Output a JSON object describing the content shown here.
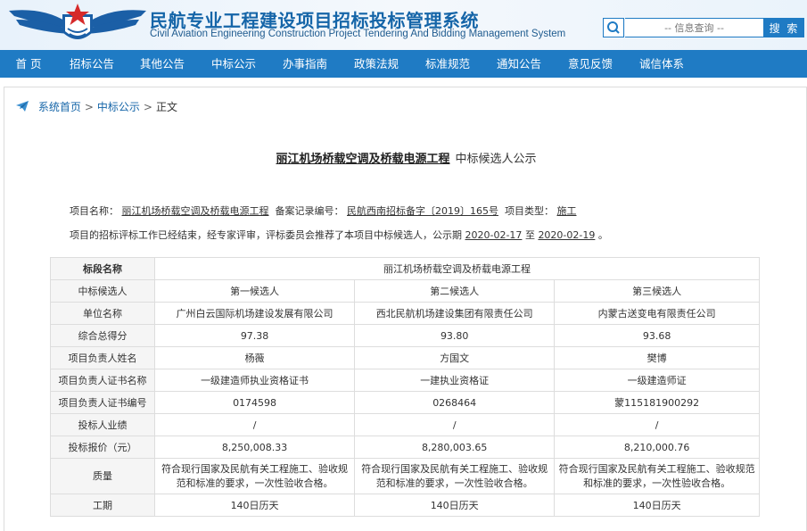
{
  "header": {
    "title_cn": "民航专业工程建设项目招标投标管理系统",
    "title_en": "Civil Aviation Engineering Construction Project Tendering And Bidding Management System",
    "search_placeholder": "-- 信息查询 --",
    "search_button": "搜 索"
  },
  "nav": {
    "items": [
      "首 页",
      "招标公告",
      "其他公告",
      "中标公示",
      "办事指南",
      "政策法规",
      "标准规范",
      "通知公告",
      "意见反馈",
      "诚信体系"
    ]
  },
  "breadcrumb": {
    "home": "系统首页",
    "section": "中标公示",
    "current": "正文",
    "separator": ">"
  },
  "document": {
    "title_project": "丽江机场桥载空调及桥载电源工程",
    "title_suffix": "中标候选人公示",
    "project_name_label": "项目名称：",
    "project_name": "丽江机场桥载空调及桥载电源工程",
    "record_no_label": "备案记录编号：",
    "record_no": "民航西南招标备字〔2019〕165号",
    "project_type_label": "项目类型：",
    "project_type": "施工",
    "notice_prefix": "项目的招标评标工作已经结束，经专家评审，评标委员会推荐了本项目中标候选人，公示期",
    "start_date": "2020-02-17",
    "to": "至",
    "end_date": "2020-02-19",
    "notice_end": "。"
  },
  "table": {
    "section_label": "标段名称",
    "section_name": "丽江机场桥载空调及桥载电源工程",
    "rows": [
      {
        "label": "中标候选人",
        "values": [
          "第一候选人",
          "第二候选人",
          "第三候选人"
        ]
      },
      {
        "label": "单位名称",
        "values": [
          "广州白云国际机场建设发展有限公司",
          "西北民航机场建设集团有限责任公司",
          "内蒙古送变电有限责任公司"
        ]
      },
      {
        "label": "综合总得分",
        "values": [
          "97.38",
          "93.80",
          "93.68"
        ]
      },
      {
        "label": "项目负责人姓名",
        "values": [
          "杨薇",
          "方国文",
          "樊博"
        ]
      },
      {
        "label": "项目负责人证书名称",
        "values": [
          "一级建造师执业资格证书",
          "一建执业资格证",
          "一级建造师证"
        ]
      },
      {
        "label": "项目负责人证书编号",
        "values": [
          "0174598",
          "0268464",
          "蒙115181900292"
        ]
      },
      {
        "label": "投标人业绩",
        "values": [
          "/",
          "/",
          "/"
        ]
      },
      {
        "label": "投标报价（元）",
        "values": [
          "8,250,008.33",
          "8,280,003.65",
          "8,210,000.76"
        ]
      },
      {
        "label": "质量",
        "values": [
          "符合现行国家及民航有关工程施工、验收规范和标准的要求，一次性验收合格。",
          "符合现行国家及民航有关工程施工、验收规范和标准的要求，一次性验收合格。",
          "符合现行国家及民航有关工程施工、验收规范和标准的要求，一次性验收合格。"
        ]
      },
      {
        "label": "工期",
        "values": [
          "140日历天",
          "140日历天",
          "140日历天"
        ]
      }
    ]
  },
  "colors": {
    "brand_blue": "#1f7bc4",
    "title_blue": "#1565a8",
    "logo_red": "#d62a2a"
  }
}
